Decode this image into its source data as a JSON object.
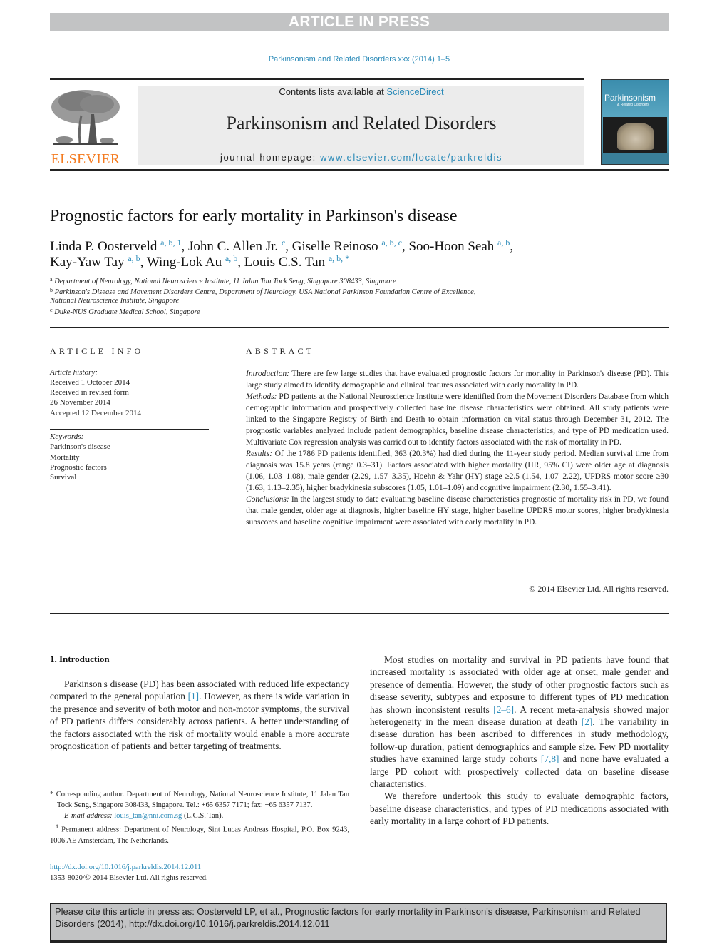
{
  "banner": {
    "label": "ARTICLE IN PRESS"
  },
  "journal_citation": "Parkinsonism and Related Disorders xxx (2014) 1–5",
  "masthead": {
    "publisher_logo_text": "ELSEVIER",
    "contents_prefix": "Contents lists available at ",
    "contents_link": "ScienceDirect",
    "journal_title": "Parkinsonism and Related Disorders",
    "homepage_prefix": "journal homepage: ",
    "homepage_url": "www.elsevier.com/locate/parkreldis",
    "cover_title": "Parkinsonism",
    "cover_subtitle": "& Related Disorders"
  },
  "article": {
    "title": "Prognostic factors for early mortality in Parkinson's disease",
    "authors_line1": [
      {
        "name": "Linda P. Oosterveld ",
        "sup": "a, b, 1",
        "sep": ", "
      },
      {
        "name": "John C. Allen Jr. ",
        "sup": "c",
        "sep": ", "
      },
      {
        "name": "Giselle Reinoso ",
        "sup": "a, b, c",
        "sep": ", "
      },
      {
        "name": "Soo-Hoon Seah ",
        "sup": "a, b",
        "sep": ","
      }
    ],
    "authors_line2": [
      {
        "name": "Kay-Yaw Tay ",
        "sup": "a, b",
        "sep": ", "
      },
      {
        "name": "Wing-Lok Au ",
        "sup": "a, b",
        "sep": ", "
      },
      {
        "name": "Louis C.S. Tan ",
        "sup": "a, b, *",
        "sep": ""
      }
    ],
    "affiliations": [
      {
        "mark": "a",
        "text": "Department of Neurology, National Neuroscience Institute, 11 Jalan Tan Tock Seng, Singapore 308433, Singapore"
      },
      {
        "mark": "b",
        "text": "Parkinson's Disease and Movement Disorders Centre, Department of Neurology, USA National Parkinson Foundation Centre of Excellence,"
      },
      {
        "mark": "",
        "text": "National Neuroscience Institute, Singapore"
      },
      {
        "mark": "c",
        "text": "Duke-NUS Graduate Medical School, Singapore"
      }
    ]
  },
  "article_info": {
    "heading": "ARTICLE INFO",
    "history_label": "Article history:",
    "history": [
      "Received 1 October 2014",
      "Received in revised form",
      "26 November 2014",
      "Accepted 12 December 2014"
    ],
    "keywords_label": "Keywords:",
    "keywords": [
      "Parkinson's disease",
      "Mortality",
      "Prognostic factors",
      "Survival"
    ]
  },
  "abstract": {
    "heading": "ABSTRACT",
    "sections": [
      {
        "label": "Introduction:",
        "text": " There are few large studies that have evaluated prognostic factors for mortality in Parkinson's disease (PD). This large study aimed to identify demographic and clinical features associated with early mortality in PD."
      },
      {
        "label": "Methods:",
        "text": " PD patients at the National Neuroscience Institute were identified from the Movement Disorders Database from which demographic information and prospectively collected baseline disease characteristics were obtained. All study patients were linked to the Singapore Registry of Birth and Death to obtain information on vital status through December 31, 2012. The prognostic variables analyzed include patient demographics, baseline disease characteristics, and type of PD medication used. Multivariate Cox regression analysis was carried out to identify factors associated with the risk of mortality in PD."
      },
      {
        "label": "Results:",
        "text": " Of the 1786 PD patients identified, 363 (20.3%) had died during the 11-year study period. Median survival time from diagnosis was 15.8 years (range 0.3–31). Factors associated with higher mortality (HR, 95% CI) were older age at diagnosis (1.06, 1.03–1.08), male gender (2.29, 1.57–3.35), Hoehn & Yahr (HY) stage ≥2.5 (1.54, 1.07–2.22), UPDRS motor score ≥30 (1.63, 1.13–2.35), higher bradykinesia subscores (1.05, 1.01–1.09) and cognitive impairment (2.30, 1.55–3.41)."
      },
      {
        "label": "Conclusions:",
        "text": " In the largest study to date evaluating baseline disease characteristics prognostic of mortality risk in PD, we found that male gender, older age at diagnosis, higher baseline HY stage, higher baseline UPDRS motor scores, higher bradykinesia subscores and baseline cognitive impairment were associated with early mortality in PD."
      }
    ],
    "copyright": "© 2014 Elsevier Ltd. All rights reserved."
  },
  "body": {
    "section_heading": "1.  Introduction",
    "left_para": {
      "before": "Parkinson's disease (PD) has been associated with reduced life expectancy compared to the general population ",
      "ref": "[1]",
      "after": ". However, as there is wide variation in the presence and severity of both motor and non-motor symptoms, the survival of PD patients differs considerably across patients. A better understanding of the factors associated with the risk of mortality would enable a more accurate prognostication of patients and better targeting of treatments."
    },
    "right_para1": {
      "p1": "Most studies on mortality and survival in PD patients have found that increased mortality is associated with older age at onset, male gender and presence of dementia. However, the study of other prognostic factors such as disease severity, subtypes and exposure to different types of PD medication has shown inconsistent results ",
      "ref1": "[2–6]",
      "p2": ". A recent meta-analysis showed major heterogeneity in the mean disease duration at death ",
      "ref2": "[2]",
      "p3": ". The variability in disease duration has been ascribed to differences in study methodology, follow-up duration, patient demographics and sample size. Few PD mortality studies have examined large study cohorts ",
      "ref3": "[7,8]",
      "p4": " and none have evaluated a large PD cohort with prospectively collected data on baseline disease characteristics."
    },
    "right_para2": "We therefore undertook this study to evaluate demographic factors, baseline disease characteristics, and types of PD medications associated with early mortality in a large cohort of PD patients."
  },
  "footnotes": {
    "corresponding": "* Corresponding author. Department of Neurology, National Neuroscience Institute, 11 Jalan Tan Tock Seng, Singapore 308433, Singapore. Tel.: +65 6357 7171; fax: +65 6357 7137.",
    "email_label": "E-mail address: ",
    "email": "louis_tan@nni.com.sg",
    "email_suffix": " (L.C.S. Tan).",
    "permanent_mark": "1",
    "permanent": " Permanent address: Department of Neurology, Sint Lucas Andreas Hospital, P.O. Box 9243, 1006 AE Amsterdam, The Netherlands.",
    "doi": "http://dx.doi.org/10.1016/j.parkreldis.2014.12.011",
    "issn": "1353-8020/© 2014 Elsevier Ltd. All rights reserved."
  },
  "cite_box": {
    "text": "Please cite this article in press as: Oosterveld LP, et al., Prognostic factors for early mortality in Parkinson's disease, Parkinsonism and Related Disorders (2014), http://dx.doi.org/10.1016/j.parkreldis.2014.12.011"
  }
}
